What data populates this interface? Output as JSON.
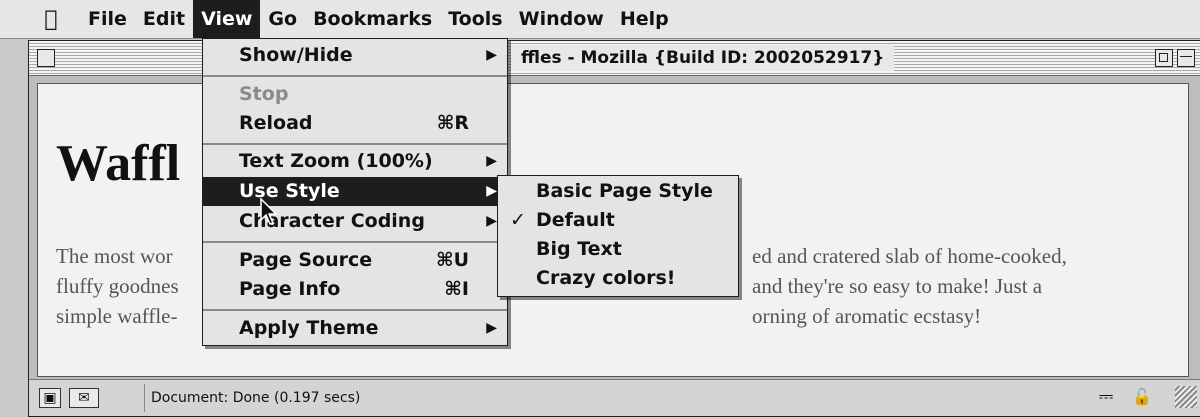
{
  "menubar": {
    "apple_icon": "apple-icon",
    "items": [
      "File",
      "Edit",
      "View",
      "Go",
      "Bookmarks",
      "Tools",
      "Window",
      "Help"
    ]
  },
  "window": {
    "title": "ffles - Mozilla {Build ID: 2002052917}"
  },
  "page": {
    "heading": "Waffl",
    "lines": [
      "The most wor",
      "fluffy goodnes",
      "simple waffle-"
    ],
    "right_lines": [
      "ed and cratered slab of home-cooked,",
      "and they're so easy to make! Just a",
      "orning of aromatic ecstasy!"
    ]
  },
  "view_menu": {
    "show_hide": "Show/Hide",
    "stop": "Stop",
    "reload": "Reload",
    "reload_shortcut": "⌘R",
    "text_zoom": "Text Zoom (100%)",
    "use_style": "Use Style",
    "character_coding": "Character Coding",
    "page_source": "Page Source",
    "page_source_shortcut": "⌘U",
    "page_info": "Page Info",
    "page_info_shortcut": "⌘I",
    "apply_theme": "Apply Theme"
  },
  "style_menu": {
    "items": [
      "Basic Page Style",
      "Default",
      "Big Text",
      "Crazy colors!"
    ],
    "checked": "Default"
  },
  "status": {
    "text": "Document: Done (0.197 secs)"
  },
  "colors": {
    "menu_highlight": "#1d1d1d",
    "menu_background": "#e4e4e4",
    "disabled_text": "#8a8a8a"
  }
}
